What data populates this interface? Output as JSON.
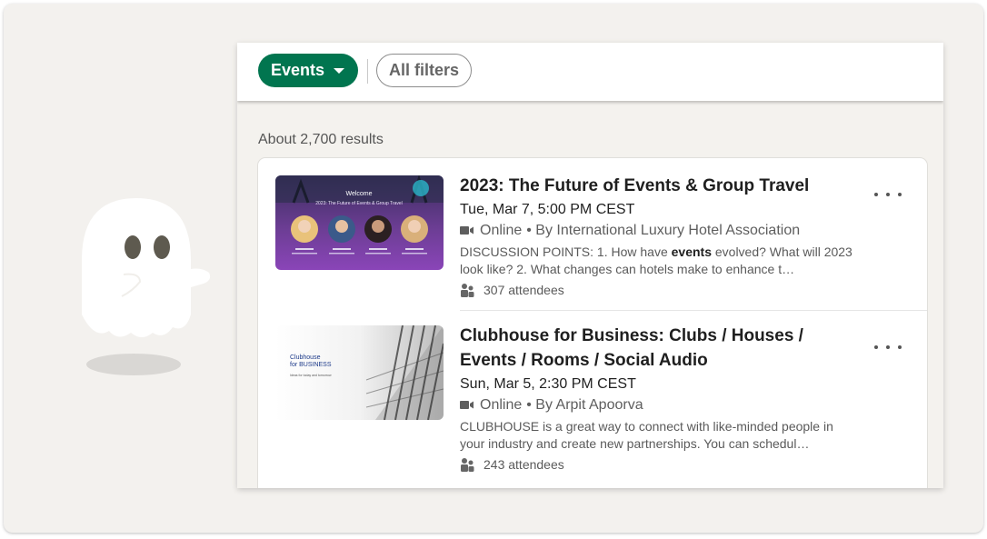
{
  "filters": {
    "events_label": "Events",
    "all_filters_label": "All filters"
  },
  "results": {
    "count_text": "About 2,700 results"
  },
  "events": [
    {
      "title": "2023: The Future of Events & Group Travel",
      "date": "Tue, Mar 7, 5:00 PM CEST",
      "format": "Online",
      "organizer": "• By International Luxury Hotel Association",
      "desc_before": "DISCUSSION POINTS: 1. How have ",
      "desc_bold": "events",
      "desc_after": " evolved? What will 2023 look like? 2. What changes can hotels make to enhance t…",
      "attendees": "307 attendees",
      "thumb_welcome": "Welcome",
      "thumb_title": "2023: The Future of Events & Group Travel"
    },
    {
      "title": "Clubhouse for Business: Clubs / Houses / Events / Rooms / Social Audio",
      "date": "Sun, Mar 5, 2:30 PM CEST",
      "format": "Online",
      "organizer": "• By Arpit Apoorva",
      "desc": "CLUBHOUSE is a great way to connect with like-minded people in your industry and create new partnerships. You can schedul…",
      "attendees": "243 attendees",
      "thumb_line1": "Clubhouse",
      "thumb_line2": "for BUSINESS",
      "thumb_line3": "Ideas for today and tomorrow"
    }
  ],
  "colors": {
    "events_button": "#01754f",
    "background": "#f3f1ee",
    "panel": "#f4f2ee"
  },
  "icons": {
    "video": "video-camera-icon",
    "people": "people-icon",
    "more": "overflow-menu-icon",
    "caret": "caret-down-icon"
  }
}
